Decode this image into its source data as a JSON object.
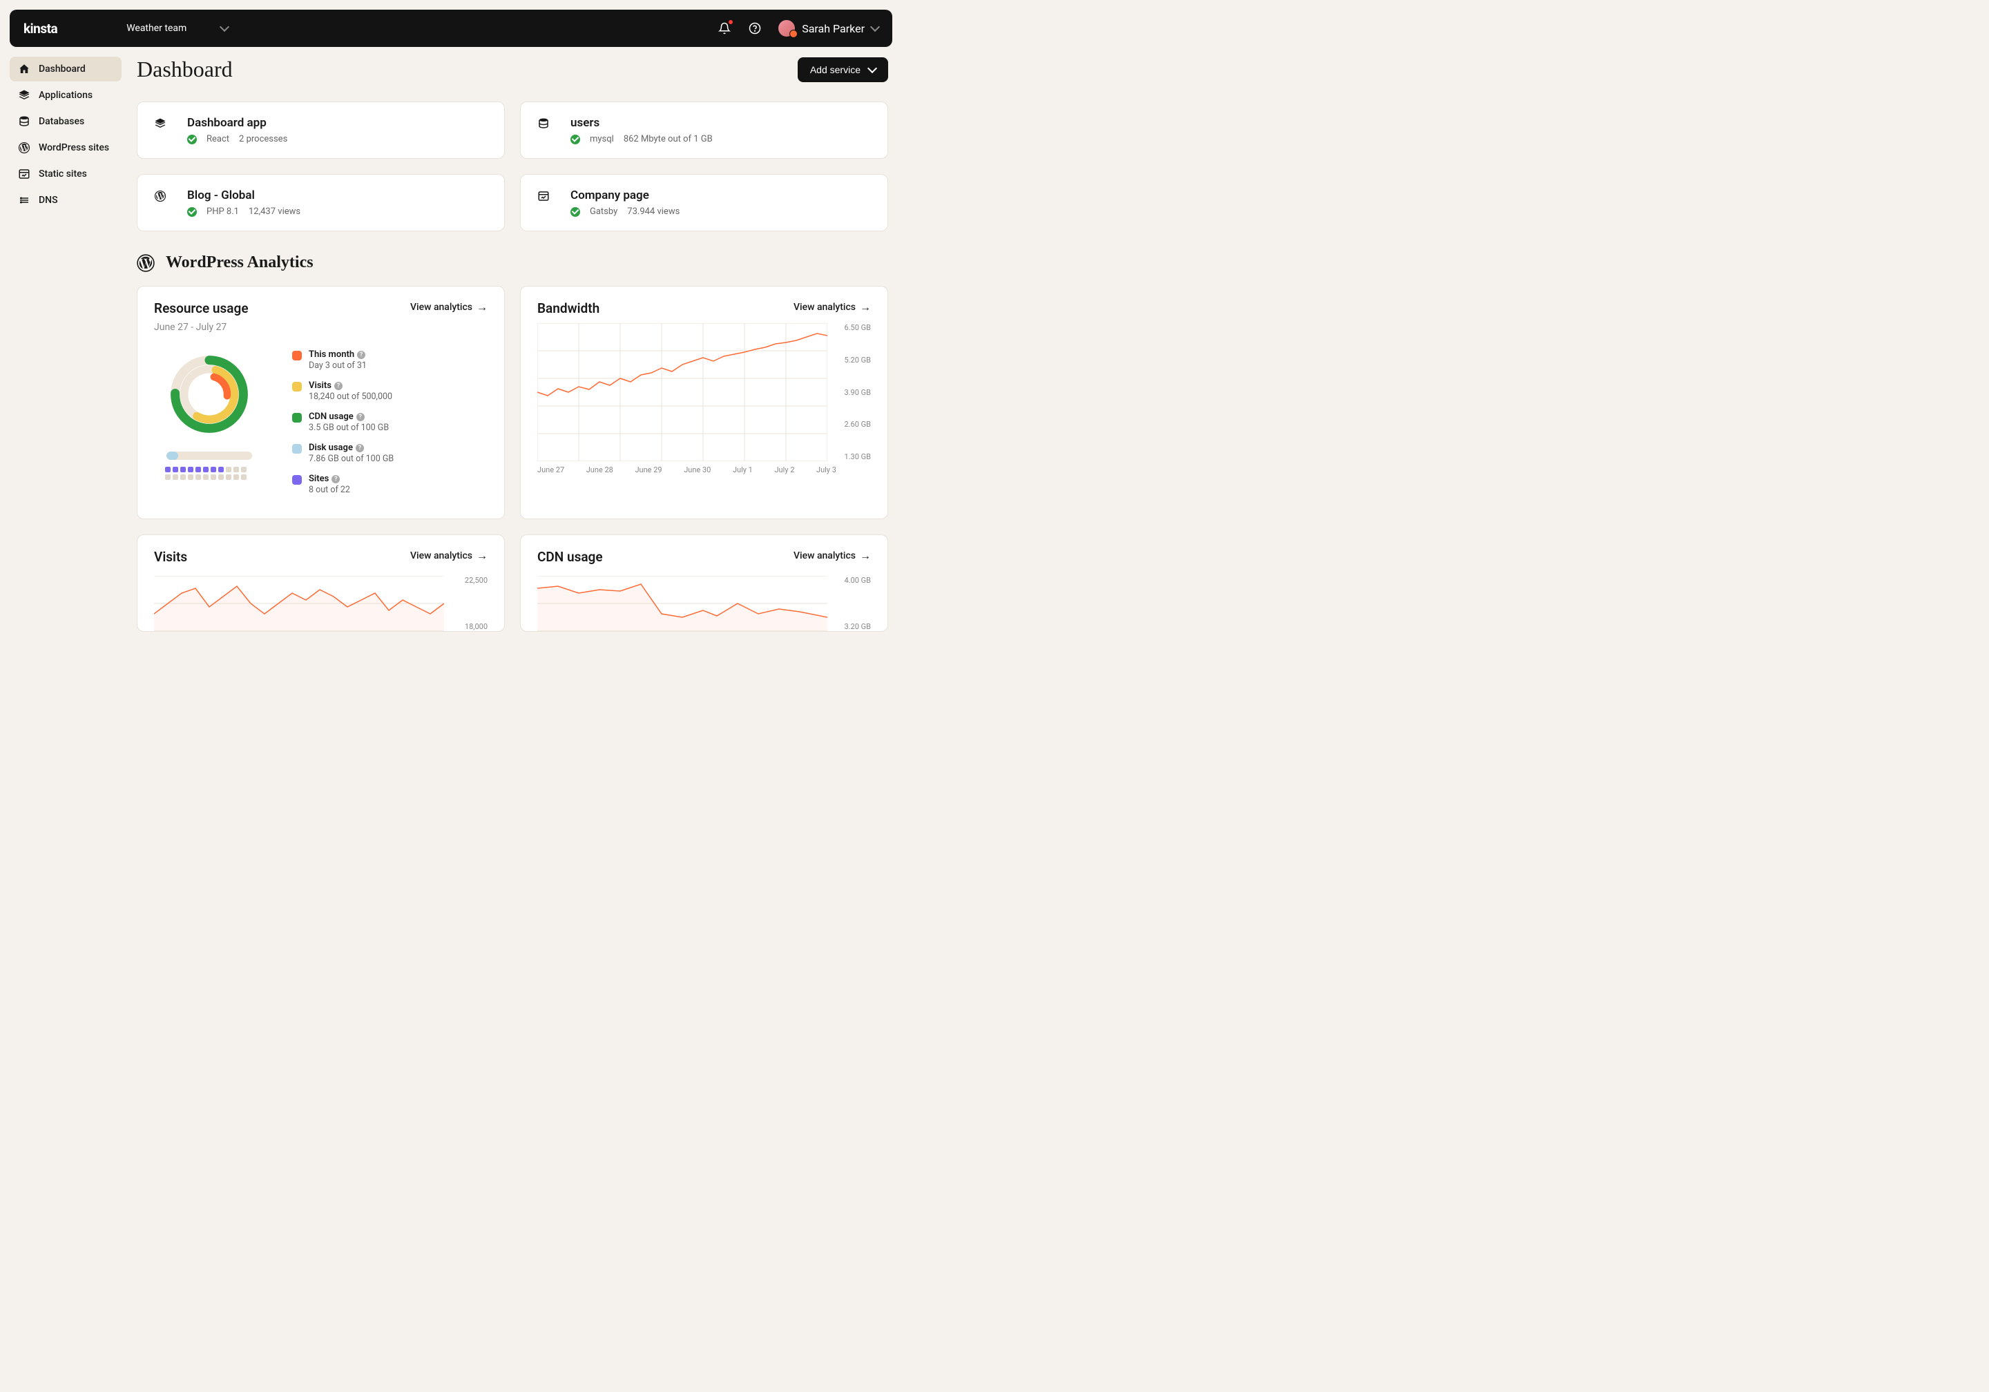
{
  "header": {
    "logo": "kinsta",
    "team": "Weather team",
    "user": "Sarah Parker"
  },
  "sidebar": {
    "items": [
      {
        "label": "Dashboard",
        "icon": "home",
        "active": true
      },
      {
        "label": "Applications",
        "icon": "layers"
      },
      {
        "label": "Databases",
        "icon": "database"
      },
      {
        "label": "WordPress sites",
        "icon": "wordpress"
      },
      {
        "label": "Static sites",
        "icon": "static"
      },
      {
        "label": "DNS",
        "icon": "dns"
      }
    ]
  },
  "page": {
    "title": "Dashboard",
    "add_button": "Add service"
  },
  "services": [
    {
      "title": "Dashboard app",
      "tech": "React",
      "meta2": "2 processes",
      "icon": "layers"
    },
    {
      "title": "users",
      "tech": "mysql",
      "meta2": "862 Mbyte out of 1 GB",
      "icon": "database"
    },
    {
      "title": "Blog - Global",
      "tech": "PHP 8.1",
      "meta2": "12,437 views",
      "icon": "wordpress"
    },
    {
      "title": "Company page",
      "tech": "Gatsby",
      "meta2": "73.944 views",
      "icon": "static"
    }
  ],
  "analytics_section": "WordPress Analytics",
  "resource": {
    "title": "Resource usage",
    "view": "View analytics",
    "date_range": "June 27 - July 27",
    "legend": [
      {
        "color": "#ff6b35",
        "label": "This month",
        "value": "Day 3 out of 31"
      },
      {
        "color": "#f2c94c",
        "label": "Visits",
        "value": "18,240 out of 500,000"
      },
      {
        "color": "#2ea043",
        "label": "CDN usage",
        "value": "3.5 GB out of 100 GB"
      },
      {
        "color": "#b0d4e8",
        "label": "Disk usage",
        "value": "7.86 GB out of 100 GB"
      },
      {
        "color": "#7b68ee",
        "label": "Sites",
        "value": "8 out of 22"
      }
    ],
    "progress_pct": 14,
    "dots_filled": 8,
    "dots_total": 22
  },
  "bandwidth": {
    "title": "Bandwidth",
    "view": "View analytics",
    "y_labels": [
      "6.50 GB",
      "5.20 GB",
      "3.90 GB",
      "2.60 GB",
      "1.30 GB"
    ],
    "x_labels": [
      "June 27",
      "June 28",
      "June 29",
      "June 30",
      "July 1",
      "July 2",
      "July 3"
    ]
  },
  "visits": {
    "title": "Visits",
    "view": "View analytics",
    "y_labels": [
      "22,500",
      "18,000"
    ]
  },
  "cdn": {
    "title": "CDN usage",
    "view": "View analytics",
    "y_labels": [
      "4.00 GB",
      "3.20 GB"
    ]
  },
  "chart_data": [
    {
      "type": "line",
      "title": "Bandwidth",
      "xlabel": "",
      "ylabel": "GB",
      "categories": [
        "June 27",
        "June 28",
        "June 29",
        "June 30",
        "July 1",
        "July 2",
        "July 3"
      ],
      "values": [
        3.9,
        4.2,
        4.5,
        5.0,
        5.4,
        5.7,
        6.3
      ],
      "ylim": [
        1.3,
        6.5
      ]
    },
    {
      "type": "line",
      "title": "Visits",
      "xlabel": "",
      "ylabel": "Visits",
      "x": [
        0,
        1,
        2,
        3,
        4,
        5,
        6,
        7,
        8,
        9,
        10,
        11,
        12,
        13
      ],
      "values": [
        18500,
        20000,
        21500,
        19500,
        22000,
        20500,
        19000,
        21000,
        22000,
        20000,
        19500,
        21000,
        19000,
        20000
      ],
      "ylim": [
        18000,
        22500
      ]
    },
    {
      "type": "line",
      "title": "CDN usage",
      "xlabel": "",
      "ylabel": "GB",
      "x": [
        0,
        1,
        2,
        3,
        4,
        5,
        6,
        7,
        8,
        9,
        10,
        11,
        12,
        13
      ],
      "values": [
        3.9,
        3.95,
        3.8,
        3.9,
        3.85,
        3.95,
        3.6,
        3.3,
        3.4,
        3.3,
        3.5,
        3.35,
        3.45,
        3.3
      ],
      "ylim": [
        3.2,
        4.0
      ]
    },
    {
      "type": "pie",
      "title": "Resource usage",
      "series": [
        {
          "name": "This month (days)",
          "value": 3,
          "total": 31
        },
        {
          "name": "Visits",
          "value": 18240,
          "total": 500000
        },
        {
          "name": "CDN usage (GB)",
          "value": 3.5,
          "total": 100
        },
        {
          "name": "Disk usage (GB)",
          "value": 7.86,
          "total": 100
        },
        {
          "name": "Sites",
          "value": 8,
          "total": 22
        }
      ]
    }
  ]
}
